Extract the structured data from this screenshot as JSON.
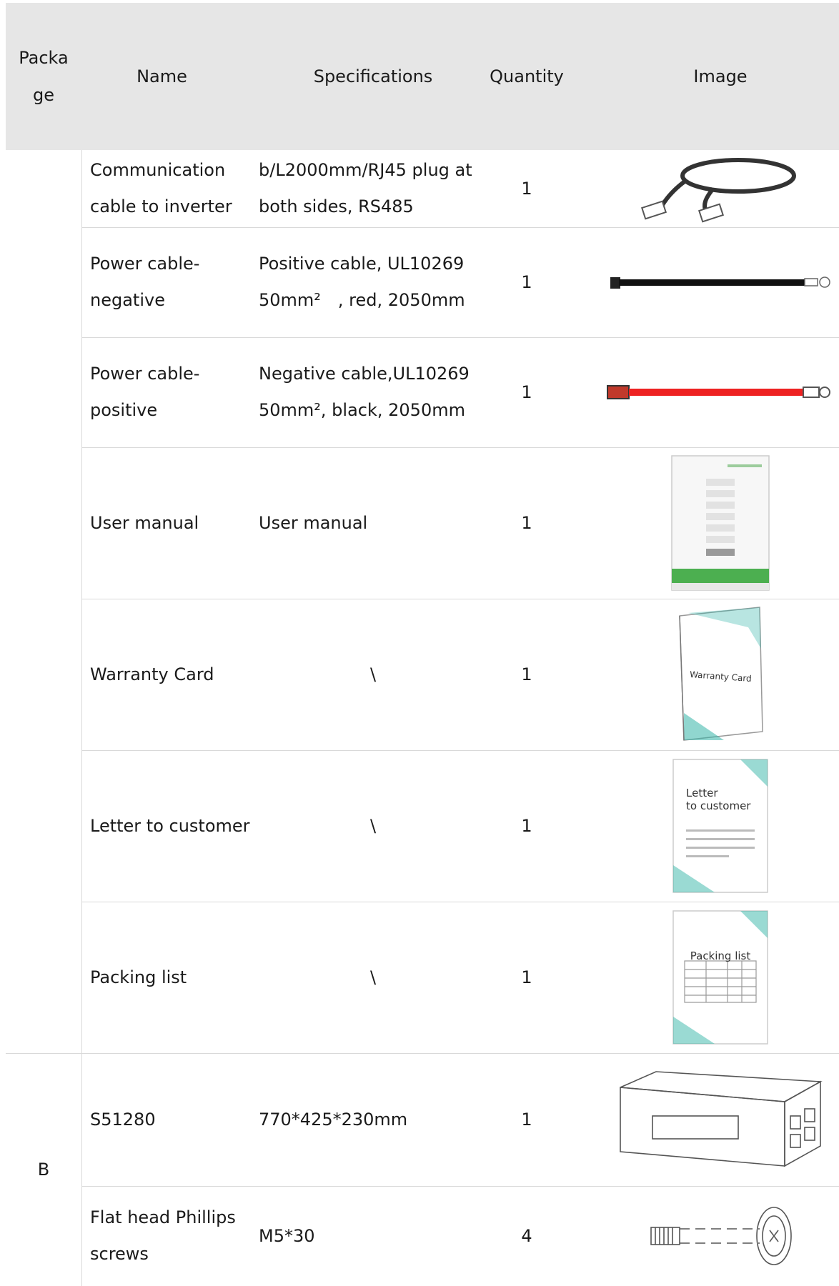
{
  "headers": {
    "package": "Packa\nge",
    "name": "Name",
    "specifications": "Specifications",
    "quantity": "Quantity",
    "image": "Image"
  },
  "groups": [
    {
      "package": "",
      "rows": [
        {
          "name": "Communication cable to inverter",
          "spec": "b/L2000mm/RJ45 plug at both sides, RS485",
          "qty": "1",
          "icon": "network-cable-icon"
        },
        {
          "name": "Power cable-negative",
          "spec": "Positive cable, UL10269 50mm²　, red, 2050mm",
          "qty": "1",
          "icon": "black-power-cable-icon"
        },
        {
          "name": "Power cable-positive",
          "spec": "Negative cable,UL10269 50mm², black, 2050mm",
          "qty": "1",
          "icon": "red-power-cable-icon"
        },
        {
          "name": "User manual",
          "spec": "User manual",
          "qty": "1",
          "icon": "user-manual-icon"
        },
        {
          "name": "Warranty Card",
          "spec": "\\",
          "qty": "1",
          "icon": "warranty-card-icon"
        },
        {
          "name": "Letter to customer",
          "spec": "\\",
          "qty": "1",
          "icon": "letter-icon"
        },
        {
          "name": "Packing list",
          "spec": "\\",
          "qty": "1",
          "icon": "packing-list-icon"
        }
      ]
    },
    {
      "package": "B",
      "rows": [
        {
          "name": "S51280",
          "spec": "770*425*230mm",
          "qty": "1",
          "icon": "battery-box-icon"
        },
        {
          "name": "Flat head Phillips screws",
          "spec": "M5*30",
          "qty": "4",
          "icon": "screw-icon"
        }
      ]
    }
  ],
  "image_text": {
    "warranty": "Warranty Card",
    "letter_line1": "Letter",
    "letter_line2": "to customer",
    "packing": "Packing list"
  },
  "colors": {
    "header_bg": "#e6e6e6",
    "accent": "#35b5a8",
    "manual_green": "#4caf50",
    "cable_red": "#ee2222"
  }
}
